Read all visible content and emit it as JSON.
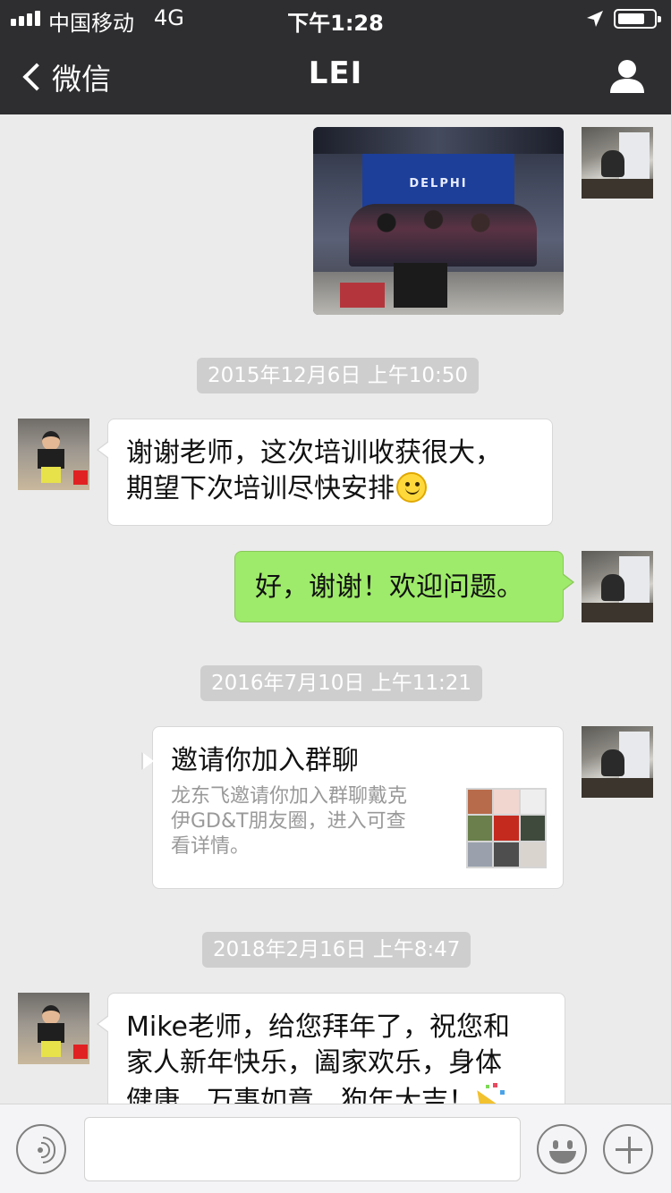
{
  "status_bar": {
    "carrier": "中国移动",
    "network": "4G",
    "time": "下午1:28",
    "battery_level": 0.75,
    "signal_bars": 4
  },
  "nav": {
    "back_label": "微信",
    "title": "LEI",
    "icons": {
      "back": "chevron-left-icon",
      "profile": "person-icon"
    }
  },
  "photo_message": {
    "sign_text": "DELPHI"
  },
  "timestamps": [
    "2015年12月6日 上午10:50",
    "2016年7月10日 上午11:21",
    "2018年2月16日 上午8:47"
  ],
  "messages": {
    "msg1": {
      "lines": [
        "谢谢老师，这次培训收获很大，",
        "期望下次培训尽快安排"
      ],
      "emoji": "smile-emoji"
    },
    "msg2": {
      "text": "好，谢谢！欢迎问题。"
    },
    "invite": {
      "title": "邀请你加入群聊",
      "desc_lines": [
        "龙东飞邀请你加入群聊戴克",
        "伊GD&T朋友圈，进入可查",
        "看详情。"
      ],
      "grid_colors": [
        "#b86b4a",
        "#f1d6d0",
        "#eeeeee",
        "#6a7f4b",
        "#c42a1e",
        "#3f4a3c",
        "#9aa1ad",
        "#4e4e4e",
        "#d9d4ce"
      ]
    },
    "msg3": {
      "lines": [
        "Mike老师，给您拜年了，祝您和",
        "家人新年快乐，阖家欢乐，身体",
        "健康，万事如意，狗年大吉！"
      ],
      "emoji": "party-popper-emoji"
    }
  },
  "colors": {
    "nav_bg": "#2e2e30",
    "chat_bg": "#ebebeb",
    "sent_bubble": "#9eea6a",
    "received_bubble": "#ffffff",
    "timestamp_bg": "#cecece"
  },
  "input_bar": {
    "icons": {
      "voice": "voice-icon",
      "emoji": "smiley-icon",
      "more": "plus-icon"
    }
  }
}
